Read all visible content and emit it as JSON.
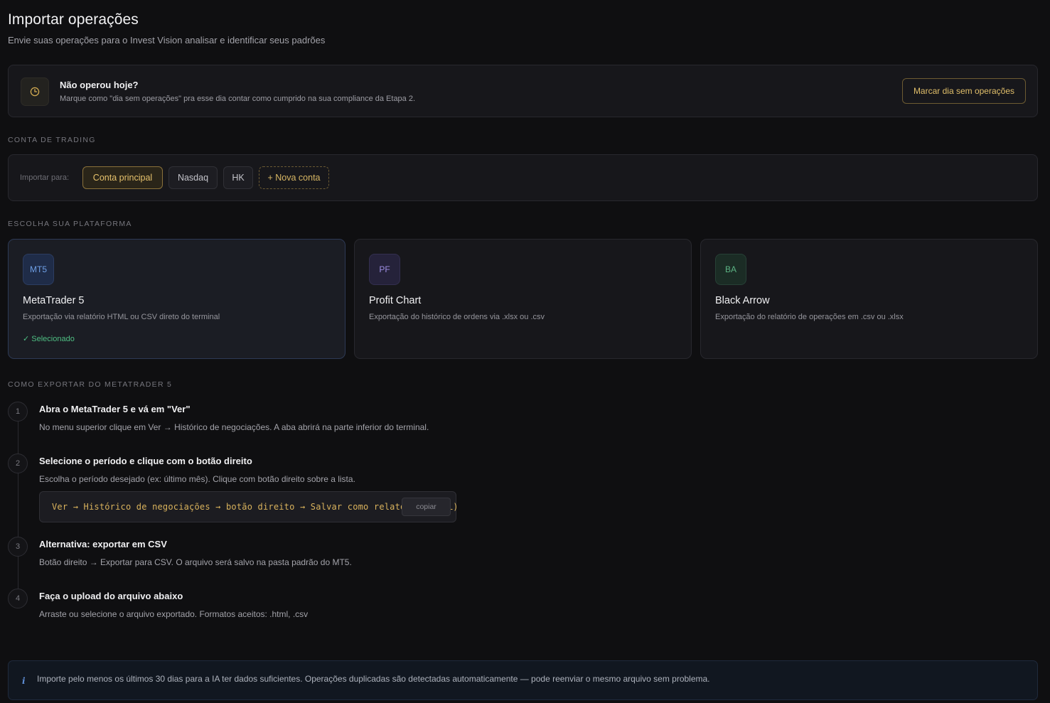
{
  "header": {
    "title": "Importar operações",
    "subtitle": "Envie suas operações para o Invest Vision analisar e identificar seus padrões"
  },
  "no_ops": {
    "icon": "clock-icon",
    "title": "Não operou hoje?",
    "description": "Marque como \"dia sem operações\" pra esse dia contar como cumprido na sua compliance da Etapa 2.",
    "button": "Marcar dia sem operações"
  },
  "account_section": {
    "label": "CONTA DE TRADING",
    "import_to": "Importar para:",
    "accounts": [
      "Conta principal",
      "Nasdaq",
      "HK"
    ],
    "selected": "Conta principal",
    "new_account": "+ Nova conta"
  },
  "platform_section": {
    "label": "ESCOLHA SUA PLATAFORMA",
    "platforms": [
      {
        "badge": "MT5",
        "name": "MetaTrader 5",
        "desc": "Exportação via relatório HTML ou CSV direto do terminal",
        "selected_label": "✓ Selecionado"
      },
      {
        "badge": "PF",
        "name": "Profit Chart",
        "desc": "Exportação do histórico de ordens via .xlsx ou .csv"
      },
      {
        "badge": "BA",
        "name": "Black Arrow",
        "desc": "Exportação do relatório de operações em .csv ou .xlsx"
      }
    ]
  },
  "steps_section": {
    "label": "COMO EXPORTAR DO METATRADER 5",
    "steps": [
      {
        "num": "1",
        "title": "Abra o MetaTrader 5 e vá em \"Ver\"",
        "desc": "No menu superior clique em Ver → Histórico de negociações. A aba abrirá na parte inferior do terminal."
      },
      {
        "num": "2",
        "title": "Selecione o período e clique com o botão direito",
        "desc": "Escolha o período desejado (ex: último mês). Clique com botão direito sobre a lista."
      },
      {
        "num": "3",
        "title": "Alternativa: exportar em CSV",
        "desc": "Botão direito → Exportar para CSV. O arquivo será salvo na pasta padrão do MT5."
      },
      {
        "num": "4",
        "title": "Faça o upload do arquivo abaixo",
        "desc": "Arraste ou selecione o arquivo exportado. Formatos aceitos: .html, .csv"
      }
    ],
    "code": "Ver → Histórico de negociações → botão direito → Salvar como relatório (HTML)",
    "copy_label": "copiar"
  },
  "info": {
    "icon": "info-icon",
    "text": "Importe pelo menos os últimos 30 dias para a IA ter dados suficientes. Operações duplicadas são detectadas automaticamente — pode reenviar o mesmo arquivo sem problema."
  },
  "colors": {
    "background": "#0f0f11",
    "gold": "#e1bf6a",
    "selected_green": "#4fbf83",
    "mt5_blue": "#6fa0e6"
  }
}
